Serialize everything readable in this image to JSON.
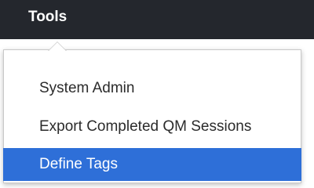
{
  "navbar": {
    "tools_label": "Tools"
  },
  "dropdown": {
    "items": [
      {
        "label": "System Admin"
      },
      {
        "label": "Export Completed QM Sessions"
      },
      {
        "label": "Define Tags",
        "selected": true
      }
    ]
  },
  "colors": {
    "navbar_bg": "#24272d",
    "highlight": "#2e6fd8",
    "text": "#2b2b2b"
  }
}
